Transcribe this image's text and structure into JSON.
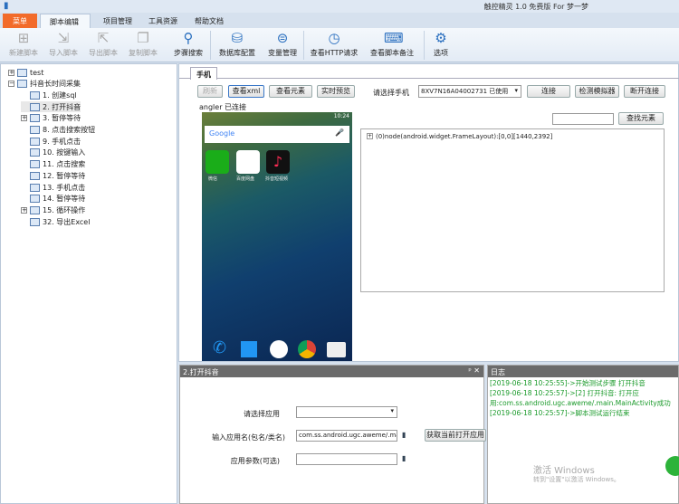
{
  "app": {
    "title": "触控精灵 1.0 免费版 For 梦一梦"
  },
  "tabs": [
    "菜单",
    "脚本编辑",
    "项目管理",
    "工具资源",
    "帮助文档"
  ],
  "ribbon": [
    {
      "label": "新建脚本",
      "icon": "plus-icon",
      "g": "⊞",
      "disabled": true
    },
    {
      "label": "导入脚本",
      "icon": "import-icon",
      "g": "⇲",
      "disabled": true
    },
    {
      "label": "导出脚本",
      "icon": "export-icon",
      "g": "⇱",
      "disabled": true
    },
    {
      "label": "复制脚本",
      "icon": "copy-icon",
      "g": "❐",
      "disabled": true
    },
    {
      "label": "步骤搜索",
      "icon": "search-icon",
      "g": "⚲",
      "disabled": false
    },
    {
      "label": "数据库配置",
      "icon": "database-icon",
      "g": "⛁",
      "disabled": false
    },
    {
      "label": "变量管理",
      "icon": "variable-icon",
      "g": "⊜",
      "disabled": false
    },
    {
      "label": "查看HTTP请求",
      "icon": "http-icon",
      "g": "◷",
      "disabled": false
    },
    {
      "label": "查看脚本备注",
      "icon": "code-icon",
      "g": "⌨",
      "disabled": false
    },
    {
      "label": "选项",
      "icon": "gear-icon",
      "g": "⚙",
      "disabled": false
    }
  ],
  "tree": [
    {
      "label": "test",
      "level": 0,
      "pm": "+",
      "icon": "database-icon"
    },
    {
      "label": "抖音长时间采集",
      "level": 0,
      "pm": "−",
      "icon": "database-icon"
    },
    {
      "label": "1. 创建sql",
      "level": 1,
      "icon": "code-icon"
    },
    {
      "label": "2. 打开抖音",
      "level": 1,
      "icon": "app-open-icon",
      "selected": true
    },
    {
      "label": "3. 暂停等待",
      "level": 1,
      "pm": "+",
      "icon": "pause-icon"
    },
    {
      "label": "8. 点击搜索按钮",
      "level": 1,
      "icon": "tap-icon"
    },
    {
      "label": "9. 手机点击",
      "level": 1,
      "icon": "tap-icon"
    },
    {
      "label": "10. 按键输入",
      "level": 1,
      "icon": "keyboard-icon"
    },
    {
      "label": "11. 点击搜索",
      "level": 1,
      "icon": "tap-icon"
    },
    {
      "label": "12. 暂停等待",
      "level": 1,
      "icon": "pause-icon"
    },
    {
      "label": "13. 手机点击",
      "level": 1,
      "icon": "tap-icon"
    },
    {
      "label": "14. 暂停等待",
      "level": 1,
      "icon": "pause-icon"
    },
    {
      "label": "15. 循环操作",
      "level": 1,
      "pm": "+",
      "icon": "loop-icon"
    },
    {
      "label": "32. 导出Excel",
      "level": 1,
      "icon": "excel-icon"
    }
  ],
  "phone_tab": "手机",
  "buttons": {
    "refresh": "刷新",
    "view_xml": "查看xml",
    "view_elements": "查看元素",
    "live_preview": "实时预览",
    "connect": "连接",
    "detect_emulator": "检测模拟器",
    "disconnect": "断开连接",
    "find_element": "查找元素"
  },
  "select_phone_label": "请选择手机",
  "selected_phone": "8XV7N16A04002731 已使用",
  "status": "angler 已连接",
  "phone": {
    "time": "10:24",
    "search": "Google",
    "apps": [
      "微信",
      "百度网盘",
      "抖音短视频"
    ]
  },
  "xml_node": "(0)node(android.widget.FrameLayout):[0,0][1440,2392]",
  "step_panel": {
    "title": "2.打开抖音",
    "select_app_label": "请选择应用",
    "app_name_label": "输入应用名(包名/类名)",
    "app_name_value": "com.ss.android.ugc.aweme/.main.MainActivity",
    "app_params_label": "应用参数(可选)",
    "get_app_button": "获取当前打开应用"
  },
  "log": {
    "title": "日志",
    "lines": [
      "[2019-06-18 10:25:55]->开始测试步骤 打开抖音",
      "[2019-06-18 10:25:57]->[2] 打开抖音: 打开应用:com.ss.android.ugc.aweme/.main.MainActivity成功",
      "[2019-06-18 10:25:57]->脚本测试运行结束"
    ]
  },
  "watermark": {
    "line1": "激活 Windows",
    "line2": "转到\"设置\"以激活 Windows。"
  }
}
